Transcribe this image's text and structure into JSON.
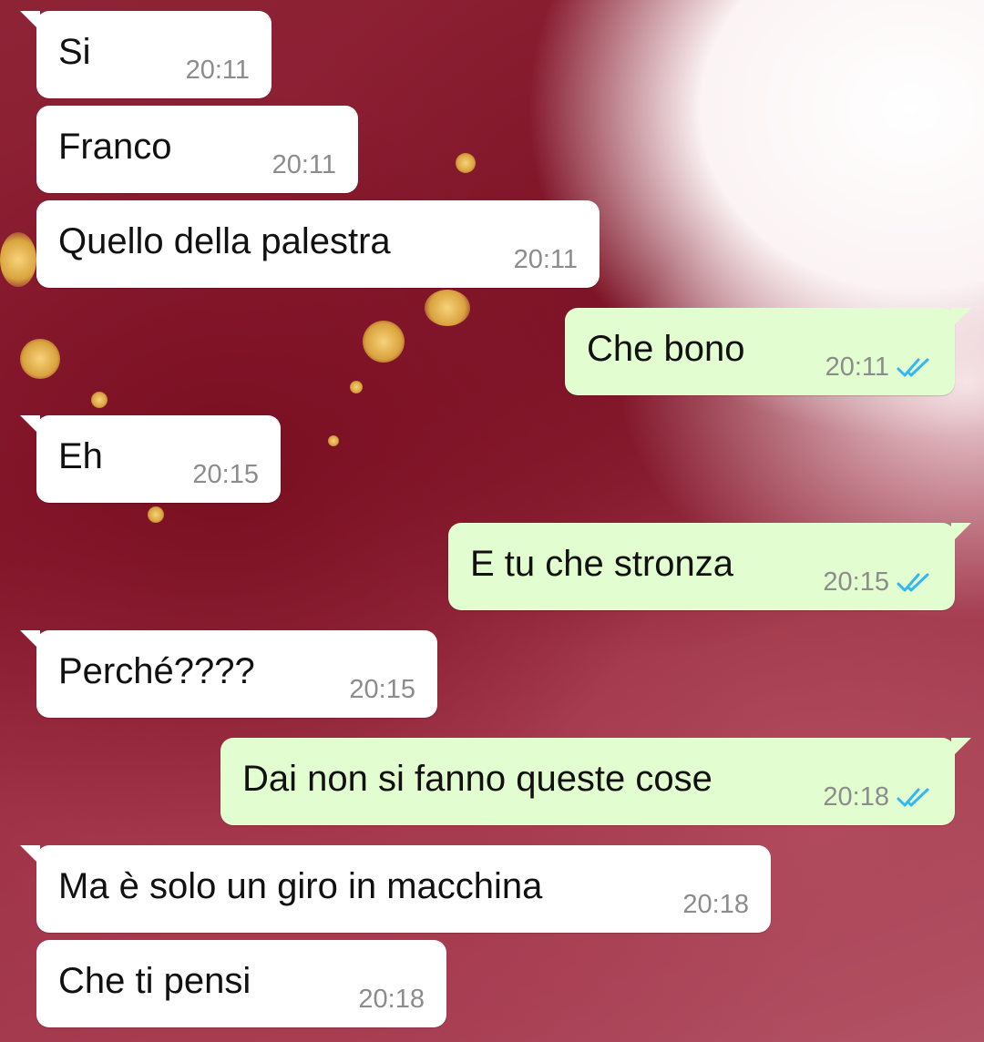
{
  "chat": {
    "colors": {
      "incoming_bubble": "#ffffff",
      "outgoing_bubble": "#e2fdcf",
      "read_ticks": "#34b7f1",
      "timestamp": "#8c8c8c",
      "wallpaper_base": "#8e2336"
    },
    "messages": [
      {
        "text": "Si",
        "time": "20:11",
        "direction": "incoming",
        "status": ""
      },
      {
        "text": "Franco",
        "time": "20:11",
        "direction": "incoming",
        "status": ""
      },
      {
        "text": "Quello della palestra",
        "time": "20:11",
        "direction": "incoming",
        "status": ""
      },
      {
        "text": "Che bono",
        "time": "20:11",
        "direction": "outgoing",
        "status": "read"
      },
      {
        "text": "Eh",
        "time": "20:15",
        "direction": "incoming",
        "status": ""
      },
      {
        "text": "E tu che stronza",
        "time": "20:15",
        "direction": "outgoing",
        "status": "read"
      },
      {
        "text": "Perché????",
        "time": "20:15",
        "direction": "incoming",
        "status": ""
      },
      {
        "text": "Dai non si fanno queste cose",
        "time": "20:18",
        "direction": "outgoing",
        "status": "read"
      },
      {
        "text": "Ma è solo un giro in macchina",
        "time": "20:18",
        "direction": "incoming",
        "status": ""
      },
      {
        "text": "Che ti pensi",
        "time": "20:18",
        "direction": "incoming",
        "status": ""
      }
    ]
  }
}
